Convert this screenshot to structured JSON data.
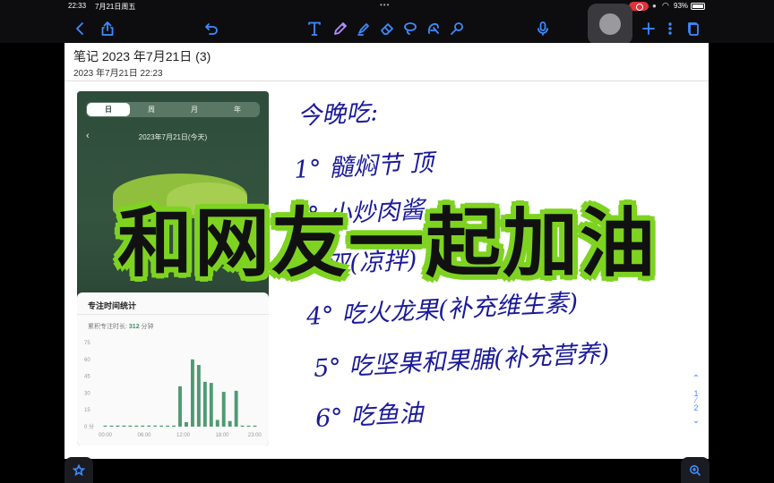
{
  "status": {
    "time": "22:33",
    "date": "7月21日周五",
    "battery": "93%"
  },
  "toolbar": {
    "icons": [
      "back-icon",
      "share-icon",
      "undo-icon",
      "text-icon",
      "pen-icon",
      "highlighter-icon",
      "eraser-icon",
      "lasso-icon",
      "shapes-icon",
      "laser-icon",
      "microphone-icon",
      "add-icon",
      "more-icon",
      "pages-icon"
    ]
  },
  "note": {
    "title": "笔记 2023 年7月21日 (3)",
    "date": "2023 年7月21日 22:23"
  },
  "screenshot": {
    "tabs": [
      "日",
      "周",
      "月",
      "年"
    ],
    "day_label": "2023年7月21日(今天)",
    "stats_title": "专注时间统计",
    "total_label": "累积专注时长:",
    "total_value": "312",
    "total_unit": "分钟",
    "chart_data": {
      "type": "bar",
      "title": "",
      "x": [
        "00:00",
        "06:00",
        "12:00",
        "18:00",
        "23:00"
      ],
      "y_ticks": [
        "0 分",
        "15",
        "30",
        "45",
        "60",
        "75"
      ],
      "ylim": [
        0,
        75
      ],
      "values": [
        0,
        0,
        0,
        0,
        0,
        0,
        0,
        0,
        0,
        0,
        0,
        0,
        36,
        4,
        60,
        55,
        40,
        39,
        6,
        31,
        5,
        32,
        0,
        0,
        0
      ],
      "color": "#4f9a72"
    }
  },
  "handwriting": {
    "lines": [
      "今晚吃:",
      "1° 髓焖节 顶",
      "2° 小炒肉酱",
      "3° 双(凉拌)",
      "4° 吃火龙果(补充维生素)",
      "5° 吃坚果和果脯(补充营养)",
      "6° 吃鱼油"
    ]
  },
  "pager": {
    "current": "1",
    "total": "2"
  },
  "banner": {
    "text": "和网友一起加油"
  },
  "colors": {
    "accent": "#3e8bff",
    "ink": "#1a1a9a",
    "banner_stroke": "#7ed321"
  }
}
